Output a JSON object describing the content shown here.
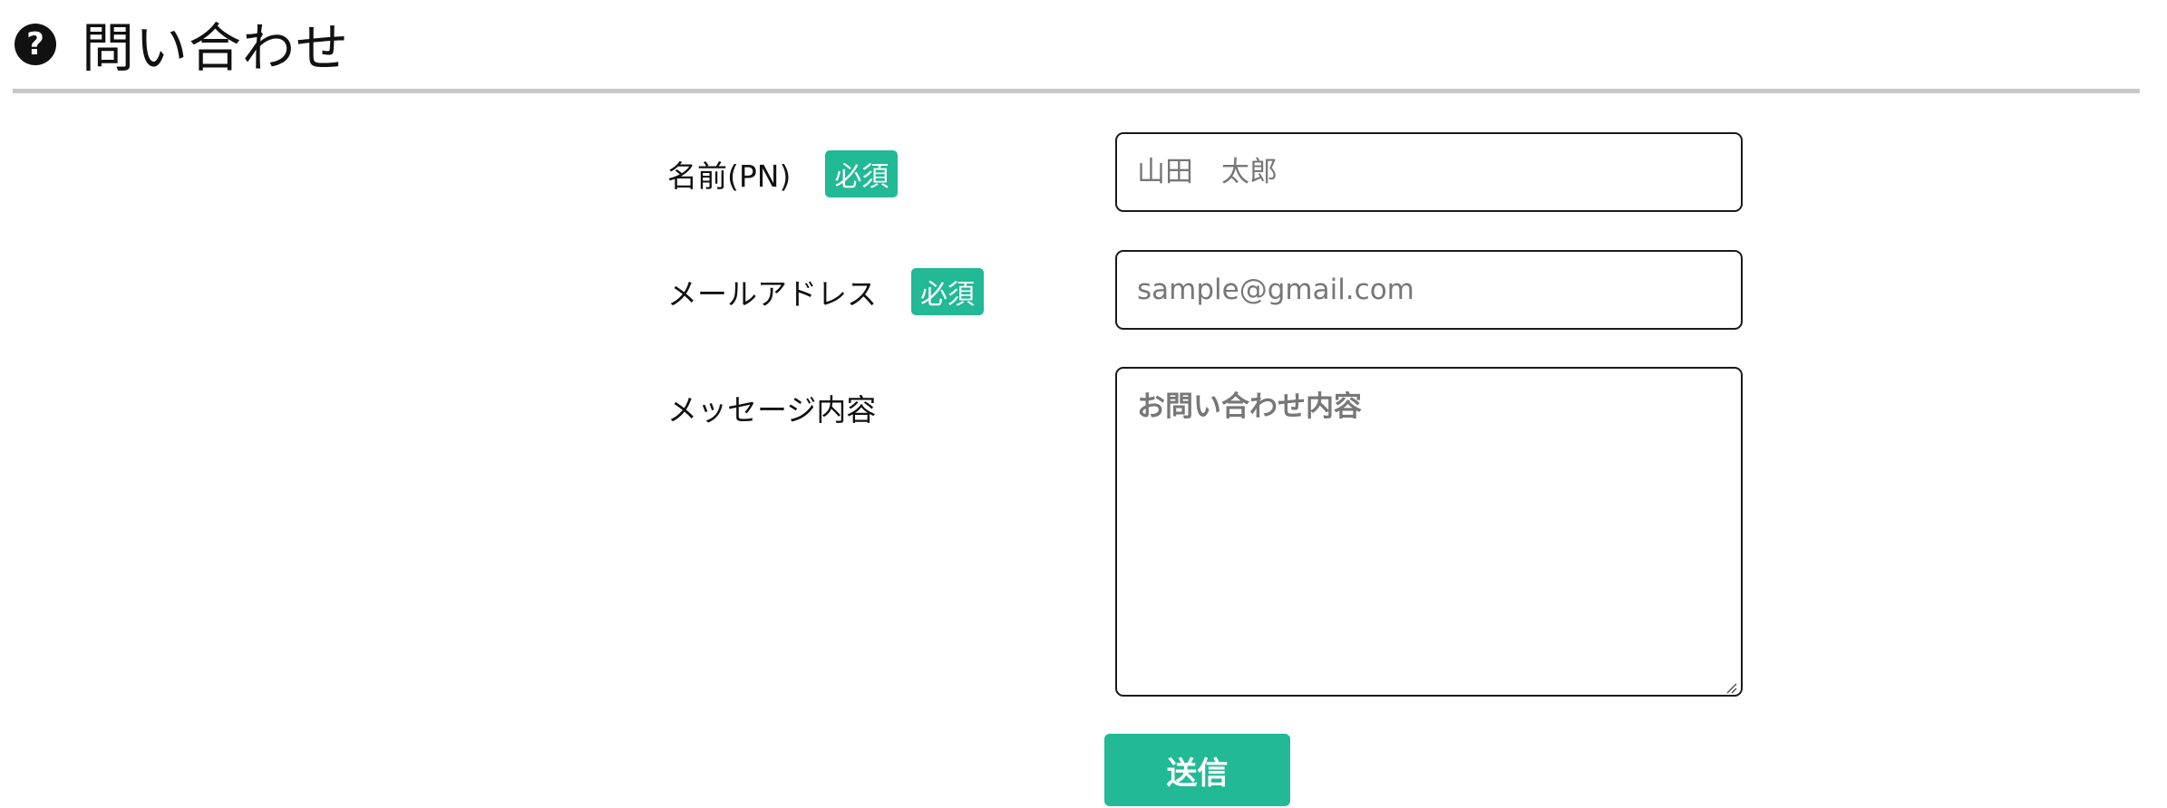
{
  "header": {
    "icon": "question-circle-icon",
    "title": "問い合わせ"
  },
  "form": {
    "name": {
      "label": "名前(PN)",
      "required_badge": "必須",
      "placeholder": "山田　太郎"
    },
    "email": {
      "label": "メールアドレス",
      "required_badge": "必須",
      "placeholder": "sample@gmail.com"
    },
    "message": {
      "label": "メッセージ内容",
      "placeholder": "お問い合わせ内容"
    },
    "submit_label": "送信"
  },
  "colors": {
    "accent": "#21b996",
    "header_rule": "#c8c8c8",
    "text": "#111111",
    "placeholder": "#777777"
  }
}
